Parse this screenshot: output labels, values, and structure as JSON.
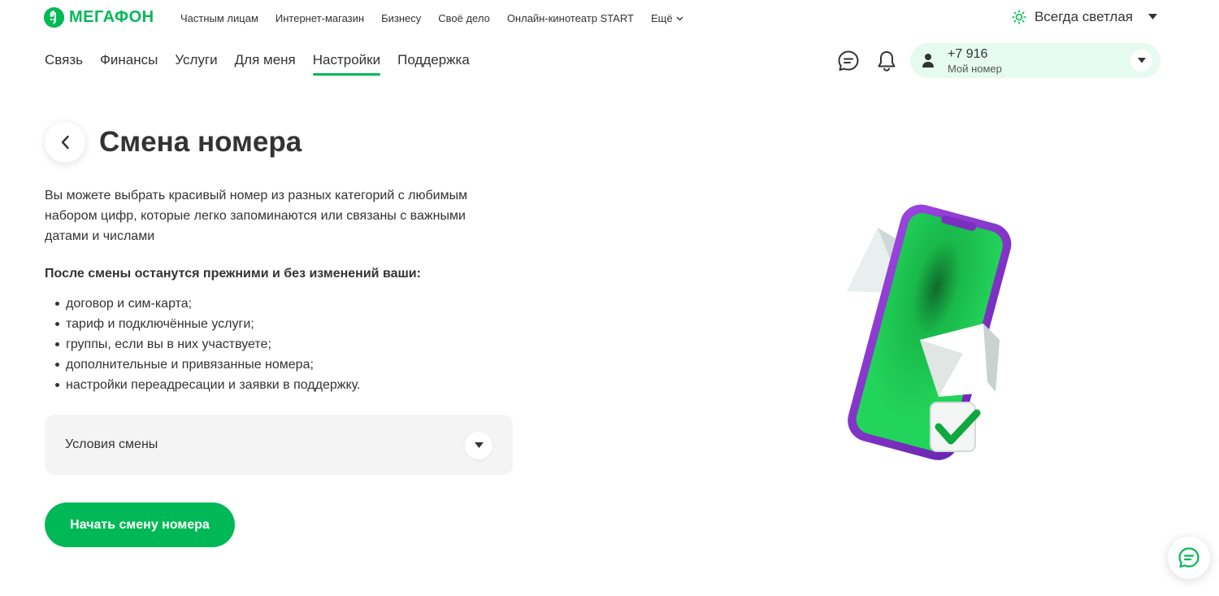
{
  "brand": {
    "name": "МЕГАФОН",
    "color": "#00b956"
  },
  "top_links": [
    "Частным лицам",
    "Интернет-магазин",
    "Бизнесу",
    "Своё дело",
    "Онлайн-кинотеатр START"
  ],
  "top_more": "Ещё",
  "theme": {
    "label": "Всегда светлая",
    "icon": "sun-icon"
  },
  "main_nav": {
    "items": [
      "Связь",
      "Финансы",
      "Услуги",
      "Для меня",
      "Настройки",
      "Поддержка"
    ],
    "active": "Настройки"
  },
  "header_icons": [
    "chat-icon",
    "bell-icon"
  ],
  "account": {
    "phone": "+7 916",
    "sublabel": "Мой номер",
    "icon": "user-icon"
  },
  "page": {
    "title": "Смена номера",
    "intro": "Вы можете выбрать красивый номер из разных категорий с любимым набором цифр, которые легко запоминаются или связаны с важными датами и числами",
    "keep_title": "После смены останутся прежними и без изменений ваши:",
    "keep_items": [
      "договор и сим-карта;",
      "тариф и подключённые услуги;",
      "группы, если вы в них участвуете;",
      "дополнительные и привязанные номера;",
      "настройки переадресации и заявки в поддержку."
    ],
    "accordion_label": "Условия смены",
    "cta_label": "Начать смену номера"
  },
  "colors": {
    "accent": "#00b956",
    "purple": "#7b2fbe",
    "accordion_bg": "#f4f4f4",
    "account_bg": "#e6fbef"
  }
}
